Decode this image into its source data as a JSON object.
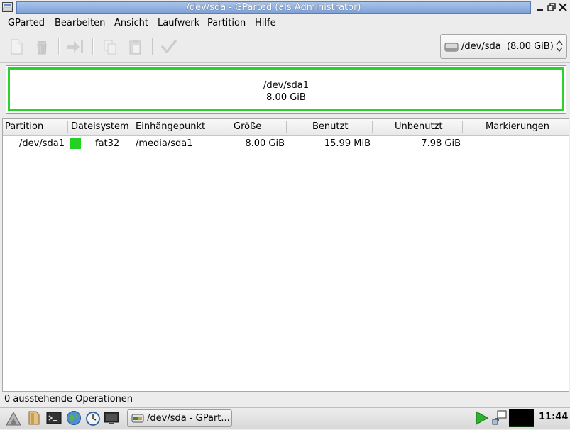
{
  "window": {
    "title": "/dev/sda - GParted (als Administrator)"
  },
  "menu": [
    {
      "label": "GParted"
    },
    {
      "label": "Bearbeiten"
    },
    {
      "label": "Ansicht"
    },
    {
      "label": "Laufwerk"
    },
    {
      "label": "Partition"
    },
    {
      "label": "Hilfe"
    }
  ],
  "toolbar": {
    "icons": [
      "new-partition-icon",
      "delete-icon",
      "resize-move-icon",
      "copy-icon",
      "paste-icon",
      "apply-icon"
    ],
    "device_selector": "/dev/sda  (8.00 GiB)"
  },
  "disk_graphic": {
    "partition_name": "/dev/sda1",
    "partition_size": "8.00 GiB",
    "color": "#2cd22c"
  },
  "table": {
    "columns": [
      "Partition",
      "Dateisystem",
      "Einhängepunkt",
      "Größe",
      "Benutzt",
      "Unbenutzt",
      "Markierungen"
    ],
    "rows": [
      {
        "partition": "/dev/sda1",
        "filesystem": "fat32",
        "fs_color": "#23d023",
        "mountpoint": "/media/sda1",
        "size": "8.00 GiB",
        "used": "15.99 MiB",
        "unused": "7.98 GiB",
        "flags": ""
      }
    ]
  },
  "status": {
    "text": "0 ausstehende Operationen"
  },
  "taskbar": {
    "window_label": "/dev/sda - GPart...",
    "clock": "11:44"
  }
}
